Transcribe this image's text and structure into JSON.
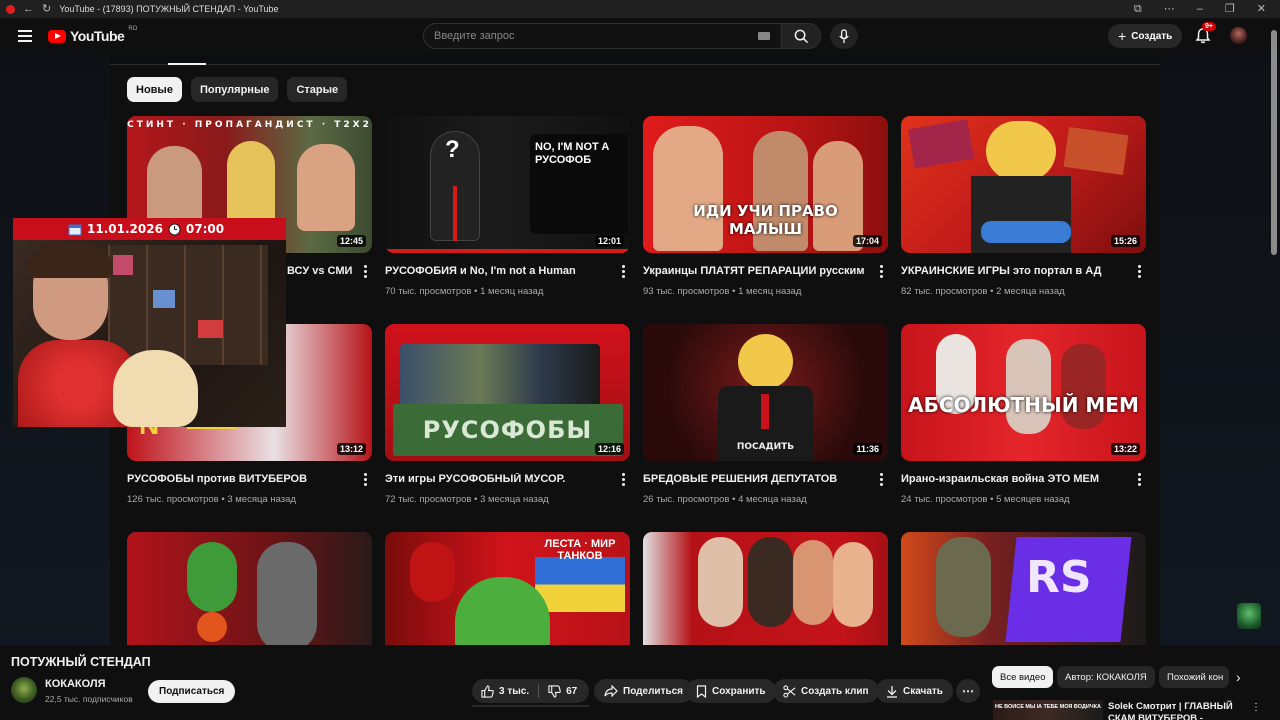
{
  "window": {
    "tab_title": "YouTube - (17893) ПОТУЖНЫЙ СТЕНДАП - YouTube"
  },
  "header": {
    "logo_text": "YouTube",
    "logo_region": "RO",
    "search_placeholder": "Введите запрос",
    "create_label": "Создать",
    "notifications_badge": "9+"
  },
  "chips": [
    "Новые",
    "Популярные",
    "Старые"
  ],
  "active_chip": "Новые",
  "videos": [
    {
      "title": "ВСУ vs СМИ",
      "views": "",
      "age": "",
      "duration": "12:45",
      "overlay": "СТИНТ · ПРОПАГАНДИСТ · Т2Х2"
    },
    {
      "title": "РУСОФОБИЯ и No, I'm not a Human",
      "views": "70 тыс. просмотров",
      "age": "1 месяц назад",
      "duration": "12:01",
      "overlay": "NO, I'M NOT A РУСОФОБ"
    },
    {
      "title": "Украинцы ПЛАТЯТ РЕПАРАЦИИ русским",
      "views": "93 тыс. просмотров",
      "age": "1 месяц назад",
      "duration": "17:04",
      "overlay": "ИДИ УЧИ ПРАВО МАЛЫШ"
    },
    {
      "title": "УКРАИНСКИЕ ИГРЫ это портал в АД",
      "views": "82 тыс. просмотров",
      "age": "2 месяца назад",
      "duration": "15:26",
      "overlay": ""
    },
    {
      "title": "РУСОФОБЫ против ВИТУБЕРОВ",
      "views": "126 тыс. просмотров",
      "age": "3 месяца назад",
      "duration": "13:12",
      "overlay": ""
    },
    {
      "title": "Эти игры РУСОФОБНЫЙ МУСОР.",
      "views": "72 тыс. просмотров",
      "age": "3 месяца назад",
      "duration": "12:16",
      "overlay": "РУСОФОБЫ"
    },
    {
      "title": "БРЕДОВЫЕ РЕШЕНИЯ ДЕПУТАТОВ",
      "views": "26 тыс. просмотров",
      "age": "4 месяца назад",
      "duration": "11:36",
      "overlay": "ПОСАДИТЬ"
    },
    {
      "title": "Ирано-израильская война ЭТО МЕМ",
      "views": "24 тыс. просмотров",
      "age": "5 месяцев назад",
      "duration": "13:22",
      "overlay": "АБСОЛЮТНЫЙ МЕМ"
    },
    {
      "title": "",
      "views": "",
      "age": "",
      "duration": "",
      "overlay": ""
    },
    {
      "title": "",
      "views": "",
      "age": "",
      "duration": "",
      "overlay": "ЛЕСТА · МИР ТАНКОВ"
    },
    {
      "title": "",
      "views": "",
      "age": "",
      "duration": "",
      "overlay": ""
    },
    {
      "title": "",
      "views": "",
      "age": "",
      "duration": "",
      "overlay": "RS"
    }
  ],
  "cam_overlay": {
    "date": "11.01.2026",
    "time": "07:00"
  },
  "player": {
    "title": "ПОТУЖНЫЙ СТЕНДАП",
    "channel_name": "КОКАКОЛЯ",
    "subscribers": "22,5 тыс. подписчиков",
    "subscribe_label": "Подписаться",
    "likes": "3 тыс.",
    "dislikes": "67",
    "share_label": "Поделиться",
    "save_label": "Сохранить",
    "clip_label": "Создать клип",
    "download_label": "Скачать"
  },
  "related": {
    "chips": [
      "Все видео",
      "Автор: КОКАКОЛЯ",
      "Похожий кон"
    ],
    "first_title": "Solek Смотрит | ГЛАВНЫЙ СКАМ ВИТУБЕРОВ -",
    "first_thumb_left": "НЕ ВОЙСЕ МЫ БЕЛЫЕ СТАЛКЕР...",
    "first_thumb_right": "А ТЕБЕ МОЯ ВОДИЧКА"
  },
  "colors": {
    "yt_red": "#ff0000",
    "background": "#0f0f0f",
    "chip": "#272727",
    "cam_bar": "#c70e1a"
  }
}
